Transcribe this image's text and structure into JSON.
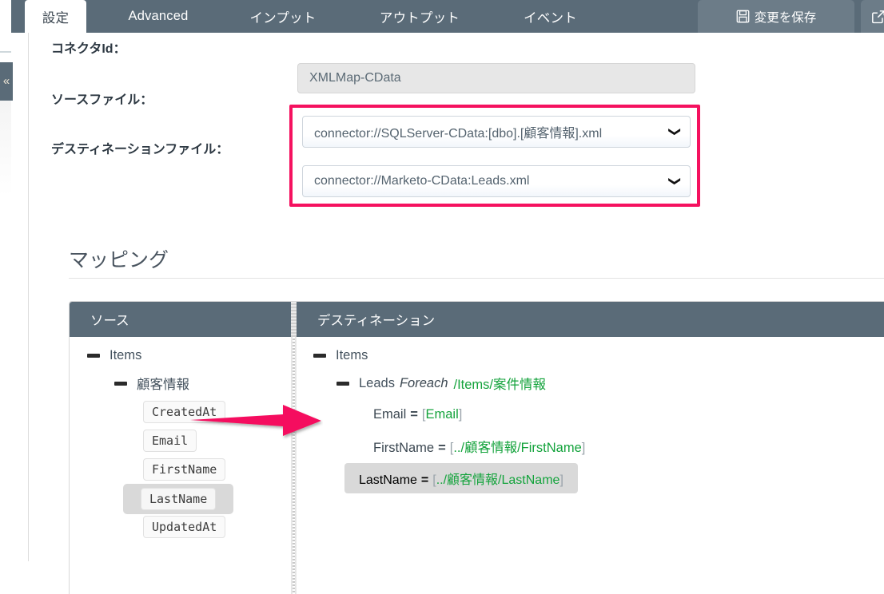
{
  "theme": {
    "header_bg": "#5a6b78",
    "button_bg": "#6c7c88",
    "accent_pink": "#f5115f",
    "path_green": "#14a33c",
    "selection_gray": "#d9d9d9"
  },
  "header": {
    "tabs": [
      {
        "label": "設定",
        "name": "tab-settings",
        "active": true
      },
      {
        "label": "Advanced",
        "name": "tab-advanced",
        "active": false
      },
      {
        "label": "インプット",
        "name": "tab-input",
        "active": false
      },
      {
        "label": "アウトプット",
        "name": "tab-output",
        "active": false
      },
      {
        "label": "イベント",
        "name": "tab-event",
        "active": false
      }
    ],
    "save_button": {
      "label": "変更を保存",
      "icon": "save-floppy-icon"
    },
    "secondary_button": {
      "label": "",
      "icon": "open-external-icon"
    }
  },
  "sidebar": {
    "collapse_handle": {
      "icon": "chevron-double-left-icon",
      "glyph": "«"
    }
  },
  "form": {
    "connector_id": {
      "label": "コネクタId：",
      "value": "XMLMap-CData",
      "readonly": true
    },
    "source_file": {
      "label": "ソースファイル：",
      "value": "connector://SQLServer-CData:[dbo].[顧客情報].xml",
      "caret_icon": "chevron-down-icon"
    },
    "destination_file": {
      "label": "デスティネーションファイル：",
      "value": "connector://Marketo-CData:Leads.xml",
      "caret_icon": "chevron-down-icon"
    },
    "highlight": {
      "color": "#f5115f",
      "around": "source-and-destination-file-selects"
    }
  },
  "mapping": {
    "title": "マッピング",
    "source_panel": {
      "header": "ソース",
      "tree": {
        "root": {
          "label": "Items",
          "toggle": "collapse-minus-icon"
        },
        "child": {
          "label": "顧客情報",
          "toggle": "collapse-minus-icon"
        },
        "leaves": [
          {
            "label": "CreatedAt",
            "selected": false
          },
          {
            "label": "Email",
            "selected": false
          },
          {
            "label": "FirstName",
            "selected": false
          },
          {
            "label": "LastName",
            "selected": true
          },
          {
            "label": "UpdatedAt",
            "selected": false
          }
        ]
      }
    },
    "destination_panel": {
      "header": "デスティネーション",
      "tree": {
        "root": {
          "label": "Items",
          "toggle": "collapse-minus-icon"
        },
        "loop": {
          "name": "Leads",
          "keyword": "Foreach",
          "path": "/Items/案件情報",
          "toggle": "collapse-minus-icon"
        },
        "rows": [
          {
            "name": "Email",
            "eq": "=",
            "open": "[",
            "path": "Email",
            "close": "]",
            "selected": false
          },
          {
            "name": "FirstName",
            "eq": "=",
            "open": "[",
            "path": "../顧客情報/FirstName",
            "close": "]",
            "selected": false
          },
          {
            "name": "LastName",
            "eq": "=",
            "open": "[",
            "path": "../顧客情報/LastName",
            "close": "]",
            "selected": true
          }
        ]
      }
    },
    "annotation_arrow": {
      "name": "mapping-arrow",
      "color": "#f5115f",
      "direction": "right"
    }
  }
}
